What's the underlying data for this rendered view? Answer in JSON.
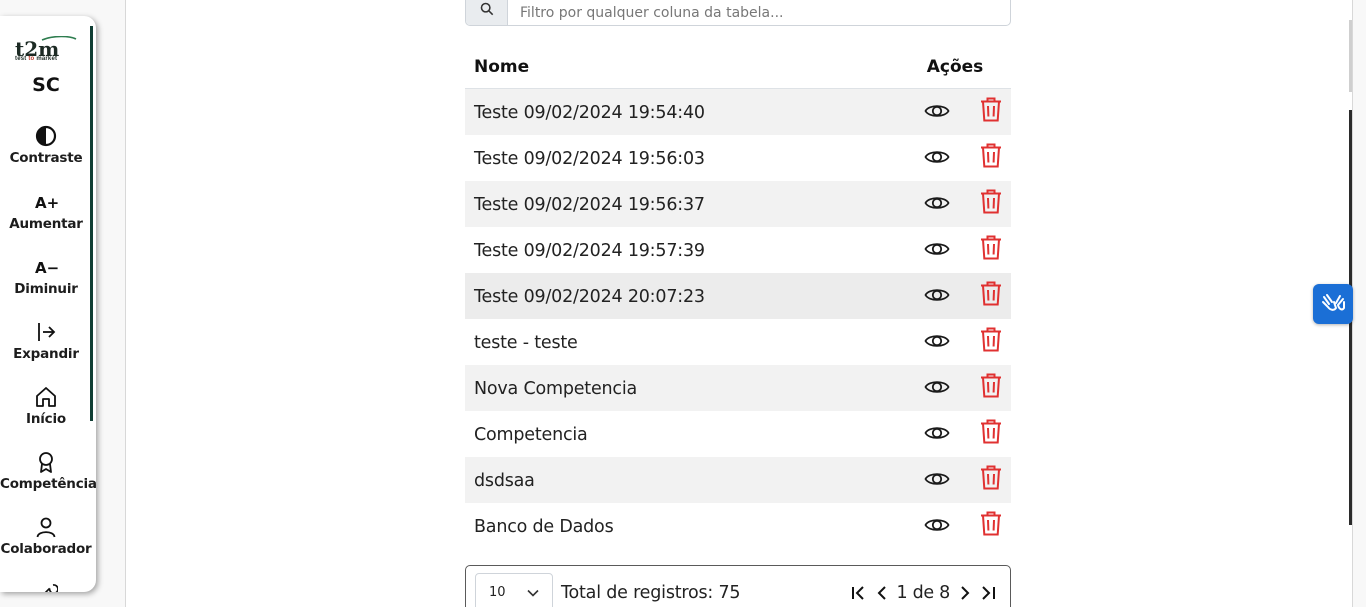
{
  "sidebar": {
    "brand_initials": "SC",
    "logo_text": "t2m",
    "logo_subtext_a": "test",
    "logo_subtext_b": "to",
    "logo_subtext_c": "market",
    "items": [
      {
        "label": "Contraste",
        "icon": "contrast-icon"
      },
      {
        "label": "Aumentar",
        "icon": "font-increase-icon",
        "glyph": "A+"
      },
      {
        "label": "Diminuir",
        "icon": "font-decrease-icon",
        "glyph": "A−"
      },
      {
        "label": "Expandir",
        "icon": "expand-icon"
      },
      {
        "label": "Início",
        "icon": "home-icon"
      },
      {
        "label": "Competência",
        "icon": "award-icon"
      },
      {
        "label": "Colaborador",
        "icon": "user-icon"
      }
    ]
  },
  "search": {
    "placeholder": "Filtro por qualquer coluna da tabela...",
    "value": ""
  },
  "table": {
    "headers": {
      "name": "Nome",
      "actions": "Ações"
    },
    "rows": [
      "Teste 09/02/2024 19:54:40",
      "Teste 09/02/2024 19:56:03",
      "Teste 09/02/2024 19:56:37",
      "Teste 09/02/2024 19:57:39",
      "Teste 09/02/2024 20:07:23",
      "teste - teste",
      "Nova Competencia",
      "Competencia",
      "dsdsaa",
      "Banco de Dados"
    ]
  },
  "pager": {
    "page_size": "10",
    "total": "Total de registros: 75",
    "page_info": "1 de 8"
  },
  "colors": {
    "accent": "#0f3d33",
    "delete": "#e03131",
    "a11y": "#1b6fd6"
  }
}
